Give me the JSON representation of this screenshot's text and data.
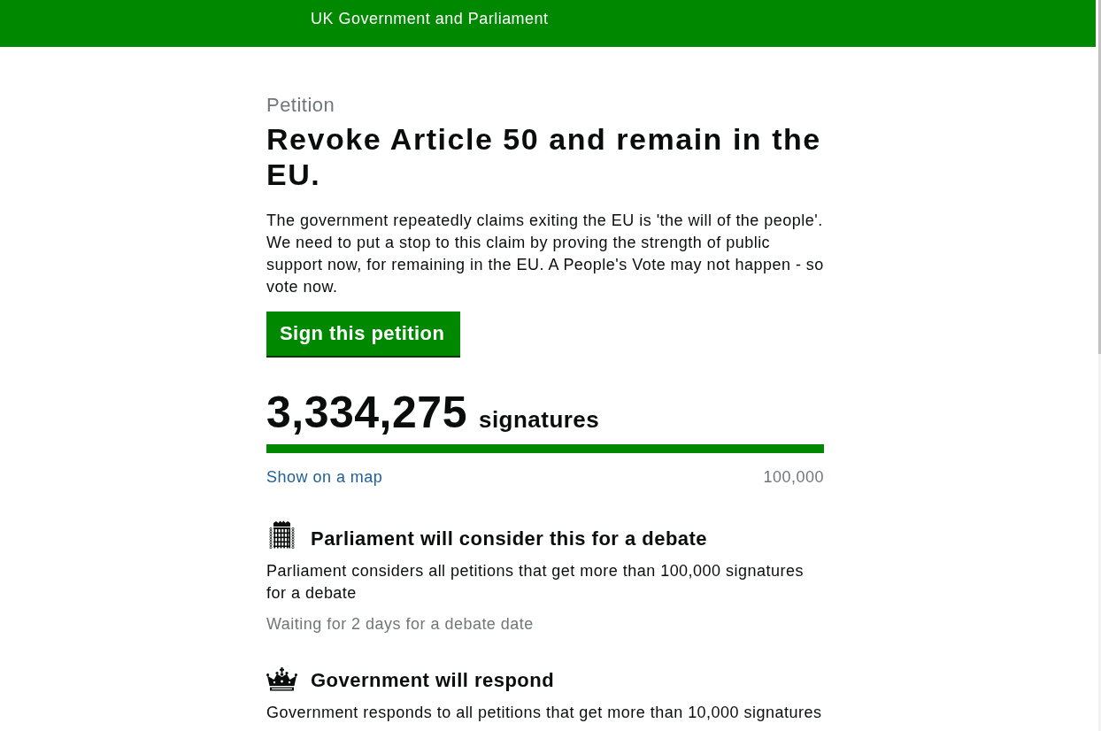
{
  "header": {
    "title": "UK Government and Parliament"
  },
  "petition": {
    "label": "Petition",
    "title": "Revoke Article 50 and remain in the EU.",
    "description": "The government repeatedly claims exiting the EU is 'the will of the people'. We need to put a stop to this claim by proving the strength of public support now, for remaining in the EU. A People's Vote may not happen - so vote now.",
    "sign_button": "Sign this petition",
    "signature_count": "3,334,275",
    "signature_unit": "signatures",
    "progress": {
      "level": 1
    },
    "map_link": "Show on a map",
    "threshold": "100,000"
  },
  "thresholds": [
    {
      "kind": "parliament",
      "heading": "Parliament will consider this for a debate",
      "text": "Parliament considers all petitions that get more than 100,000 signatures for a debate",
      "status": "Waiting for 2 days for a debate date"
    },
    {
      "kind": "government",
      "heading": "Government will respond",
      "text": "Government responds to all petitions that get more than 10,000 signatures"
    }
  ]
}
